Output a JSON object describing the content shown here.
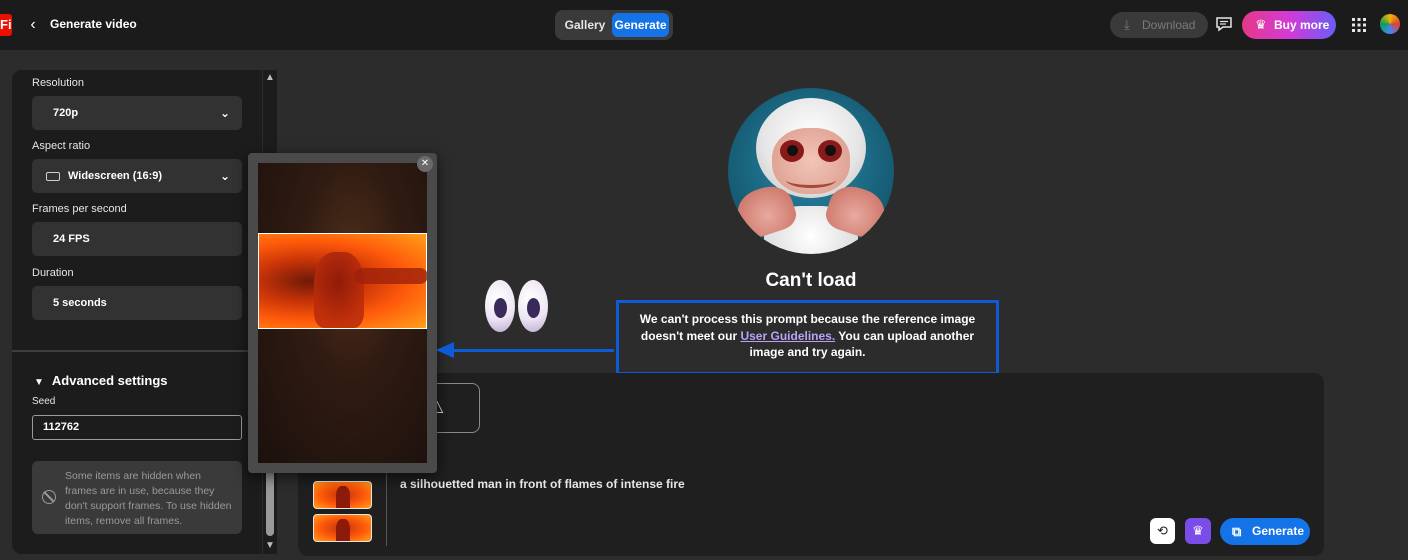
{
  "header": {
    "logo": "Fi",
    "back_icon": "chevron-left-icon",
    "title": "Generate video",
    "tabs": [
      {
        "label": "Gallery",
        "active": false
      },
      {
        "label": "Generate",
        "active": true
      }
    ],
    "download_label": "Download",
    "buy_more_label": "Buy more"
  },
  "settings": {
    "resolution": {
      "label": "Resolution",
      "value": "720p"
    },
    "aspect_ratio": {
      "label": "Aspect ratio",
      "value": "Widescreen (16:9)"
    },
    "fps": {
      "label": "Frames per second",
      "value": "24 FPS"
    },
    "duration": {
      "label": "Duration",
      "value": "5 seconds"
    },
    "advanced_label": "Advanced settings",
    "seed": {
      "label": "Seed",
      "value": "112762"
    },
    "notice": "Some items are hidden when frames are in use, because they don't support frames. To use hidden items, remove all frames."
  },
  "status": {
    "title": "Can't load",
    "message_part1": "We can't process this prompt because the reference image doesn't meet our ",
    "link_text": "User Guidelines.",
    "message_part2": " You can upload another image and try again."
  },
  "prompt": {
    "text": "a silhouetted man in front of flames of intense fire",
    "generate_label": "Generate"
  },
  "colors": {
    "accent": "#1473e6",
    "annotation_blue": "#0d5bd6",
    "link": "#b9a3f2"
  }
}
